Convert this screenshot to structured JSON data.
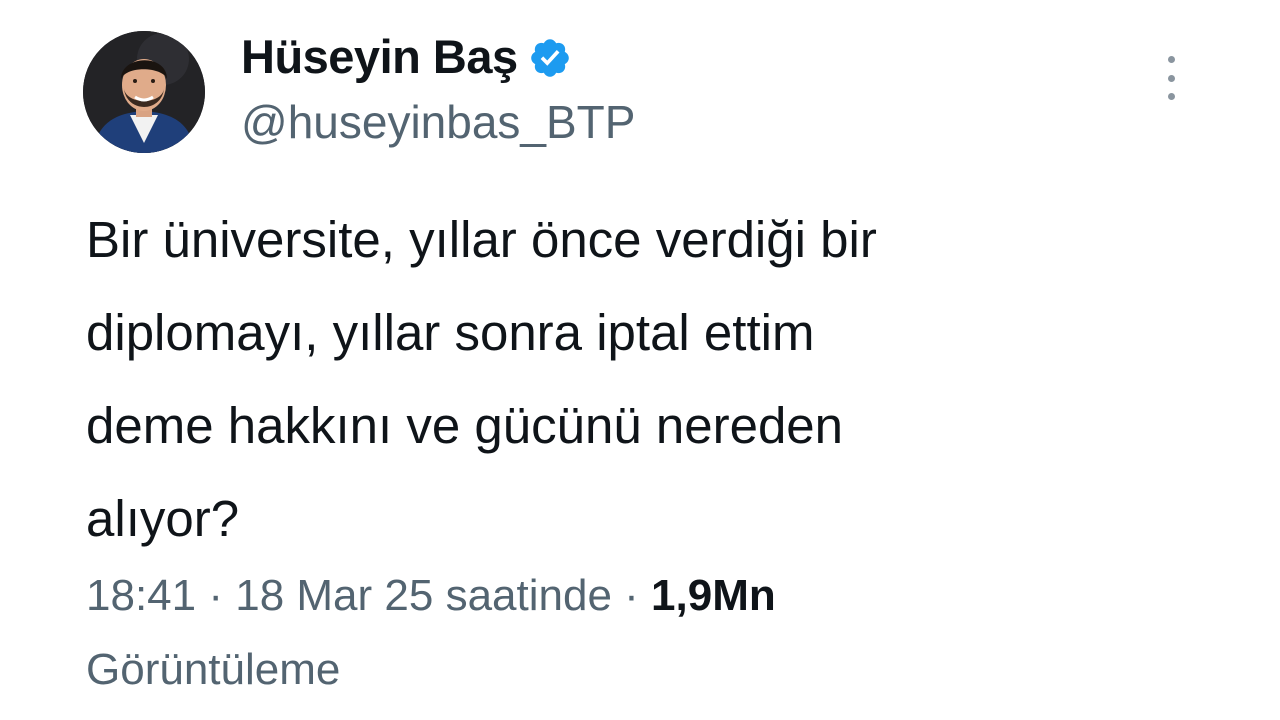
{
  "author": {
    "display_name": "Hüseyin Baş",
    "handle": "@huseyinbas_BTP",
    "verified_icon": "verified-badge-icon",
    "verified_color": "#1d9bf0"
  },
  "tweet": {
    "text": "Bir üniversite, yıllar önce verdiği bir\ndiplomayı, yıllar sonra iptal ettim\ndeme hakkını ve gücünü nereden\nalıyor?"
  },
  "meta": {
    "time": "18:41",
    "separator": "·",
    "date": "18 Mar 25 saatinde",
    "views_count": "1,9Mn",
    "views_label": "Görüntüleme"
  },
  "icons": {
    "more": "more-vertical-icon"
  }
}
